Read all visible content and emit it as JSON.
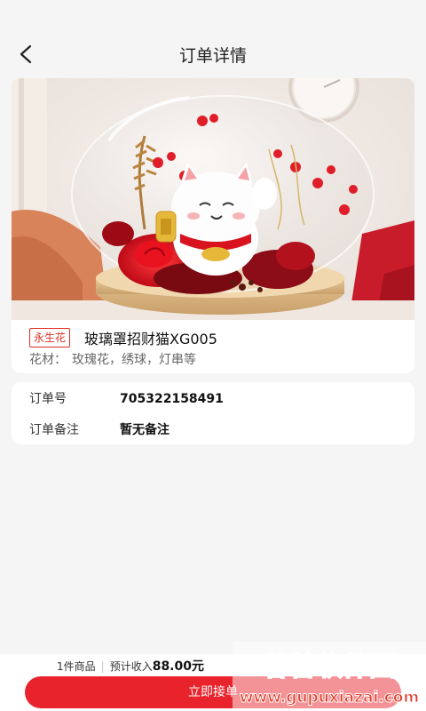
{
  "header": {
    "title": "订单详情",
    "back_icon": "back-chevron-icon"
  },
  "product": {
    "tag": "永生花",
    "name": "玻璃罩招财猫XG005",
    "material_label": "花材：",
    "material_value": "玫瑰花，绣球，灯串等",
    "image_desc_icon": "product-photo"
  },
  "order": {
    "number_label": "订单号",
    "number_value": "705322158491",
    "remark_label": "订单备注",
    "remark_value": "暂无备注"
  },
  "bottom": {
    "item_count": "1件商品",
    "income_label": "预计收入",
    "income_amount": "88.00元",
    "accept_label": "立即接单"
  },
  "colors": {
    "accent": "#e8232b",
    "tag": "#e02e24",
    "background": "#f5f5f5"
  },
  "watermark": {
    "title": "谷普软件园",
    "url": "www.gupuxiazai.com"
  }
}
